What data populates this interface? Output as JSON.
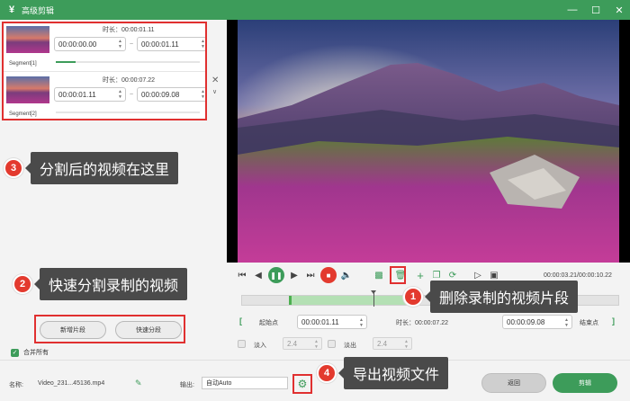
{
  "window": {
    "title": "高级剪辑",
    "logo": "¥"
  },
  "segments": [
    {
      "label": "Segment[1]",
      "duration_label": "时长：00:00:01.11",
      "start": "00:00:00.00",
      "end": "00:00:01.11"
    },
    {
      "label": "Segment[2]",
      "duration_label": "时长：00:00:07.22",
      "start": "00:00:01.11",
      "end": "00:00:09.08"
    }
  ],
  "callouts": {
    "c1": {
      "num": "1",
      "text": "删除录制的视频片段"
    },
    "c2": {
      "num": "2",
      "text": "快速分割录制的视频"
    },
    "c3": {
      "num": "3",
      "text": "分割后的视频在这里"
    },
    "c4": {
      "num": "4",
      "text": "导出视频文件"
    }
  },
  "actions": {
    "new_segment": "新增片段",
    "quick_split": "快速分段"
  },
  "merge_all": "合并所有",
  "player": {
    "timecode": "00:00:03.21/00:00:10.22"
  },
  "range": {
    "start_label": "起始点",
    "start_time": "00:00:01.11",
    "duration_label": "时长：00:00:07.22",
    "end_time": "00:00:09.08",
    "end_label": "结束点"
  },
  "fade": {
    "fade_in_label": "淡入",
    "fade_in_value": "2.4",
    "fade_out_label": "淡出",
    "fade_out_value": "2.4"
  },
  "bottom": {
    "name_label": "名称:",
    "file_name": "Video_231...45136.mp4",
    "output_label": "输出:",
    "output_value": "自动Auto",
    "return_label": "返回",
    "cut_label": "剪辑"
  },
  "colors": {
    "accent": "#3d9c5a",
    "callout_red": "#e33a2e",
    "highlight_border": "#e03030"
  }
}
